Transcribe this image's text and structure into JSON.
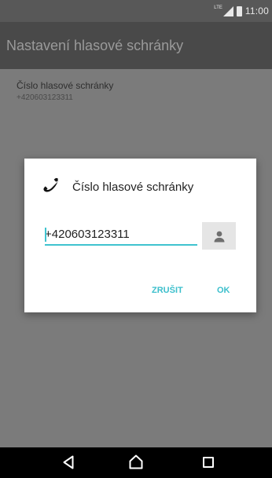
{
  "status_bar": {
    "network_label": "LTE",
    "time": "11:00",
    "signal_icon": "signal-icon",
    "battery_icon": "battery-icon"
  },
  "app_bar": {
    "title": "Nastavení hlasové schránky"
  },
  "preference": {
    "title": "Číslo hlasové schránky",
    "summary": "+420603123311"
  },
  "dialog": {
    "icon": "phone-icon",
    "title": "Číslo hlasové schránky",
    "input_value": "+420603123311",
    "contact_icon": "contact-icon",
    "cancel_label": "ZRUŠIT",
    "ok_label": "OK"
  },
  "nav_bar": {
    "back_icon": "back-icon",
    "home_icon": "home-icon",
    "recents_icon": "recents-icon"
  },
  "colors": {
    "accent": "#3fc3cf",
    "app_bar": "#494949",
    "status_bar": "#585858",
    "scrim": "#7b7b7b",
    "nav_bar": "#000000"
  }
}
